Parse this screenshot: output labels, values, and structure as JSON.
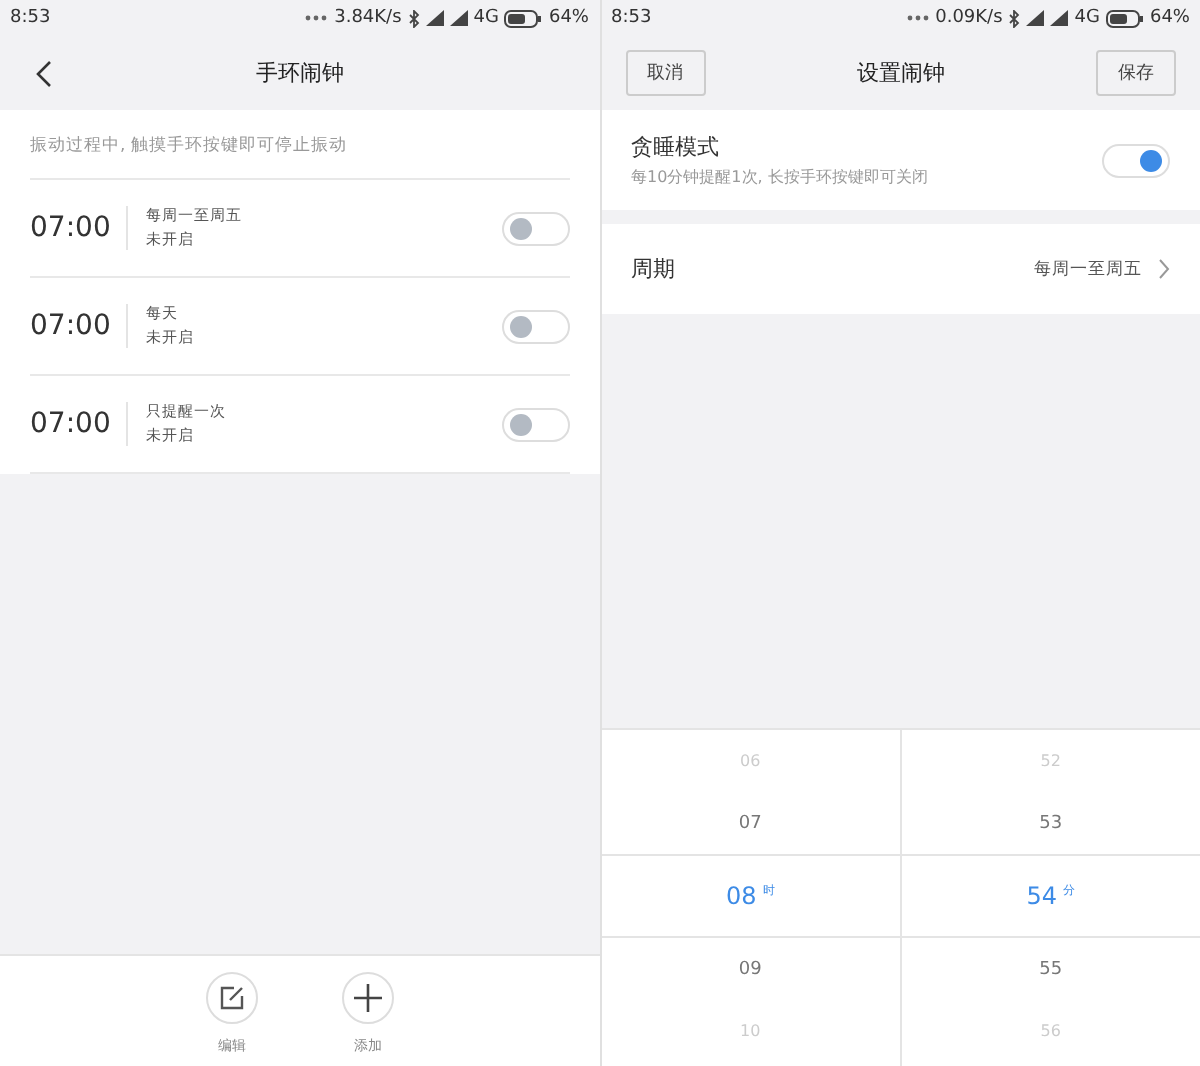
{
  "left": {
    "status_bar": {
      "time": "8:53",
      "speed": "3.84K/s",
      "network": "4G",
      "battery": "64%"
    },
    "title": "手环闹钟",
    "hint": "振动过程中, 触摸手环按键即可停止振动",
    "alarms": [
      {
        "time": "07:00",
        "repeat": "每周一至周五",
        "status": "未开启",
        "on": false
      },
      {
        "time": "07:00",
        "repeat": "每天",
        "status": "未开启",
        "on": false
      },
      {
        "time": "07:00",
        "repeat": "只提醒一次",
        "status": "未开启",
        "on": false
      }
    ],
    "toolbar": [
      {
        "kind": "edit",
        "label": "编辑"
      },
      {
        "kind": "add",
        "label": "添加"
      }
    ]
  },
  "right": {
    "status_bar": {
      "time": "8:53",
      "speed": "0.09K/s",
      "network": "4G",
      "battery": "64%"
    },
    "cancel": "取消",
    "title": "设置闹钟",
    "save": "保存",
    "snooze": {
      "label": "贪睡模式",
      "description": "每10分钟提醒1次, 长按手环按键即可关闭",
      "on": true
    },
    "period": {
      "label": "周期",
      "value": "每周一至周五"
    },
    "picker": {
      "hour_unit": "时",
      "minute_unit": "分",
      "hours": [
        {
          "value": "06",
          "selected": false
        },
        {
          "value": "07",
          "selected": false
        },
        {
          "value": "08",
          "selected": true
        },
        {
          "value": "09",
          "selected": false
        },
        {
          "value": "10",
          "selected": false
        }
      ],
      "minutes": [
        {
          "value": "52",
          "selected": false
        },
        {
          "value": "53",
          "selected": false
        },
        {
          "value": "54",
          "selected": true
        },
        {
          "value": "55",
          "selected": false
        },
        {
          "value": "56",
          "selected": false
        }
      ]
    }
  }
}
